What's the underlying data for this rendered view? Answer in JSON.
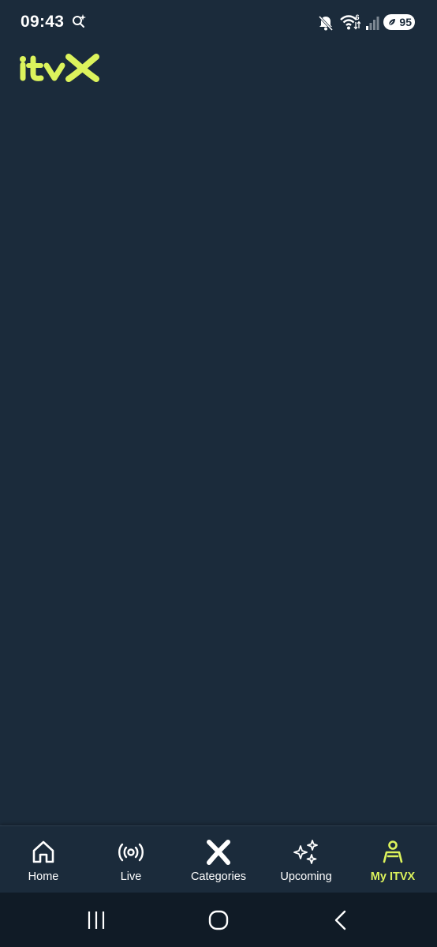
{
  "status_bar": {
    "time": "09:43",
    "battery": "95",
    "wifi_badge": "6"
  },
  "app": {
    "brand": "ITVX",
    "accent_color": "#dcf35c",
    "background_color": "#1b2b3b"
  },
  "bottom_nav": {
    "items": [
      {
        "label": "Home",
        "icon": "home-icon",
        "active": false
      },
      {
        "label": "Live",
        "icon": "live-broadcast-icon",
        "active": false
      },
      {
        "label": "Categories",
        "icon": "categories-x-icon",
        "active": false
      },
      {
        "label": "Upcoming",
        "icon": "sparkles-icon",
        "active": false
      },
      {
        "label": "My ITVX",
        "icon": "profile-icon",
        "active": true
      }
    ]
  },
  "system_nav": {
    "buttons": [
      "recent-apps-icon",
      "home-circle-icon",
      "back-icon"
    ]
  }
}
